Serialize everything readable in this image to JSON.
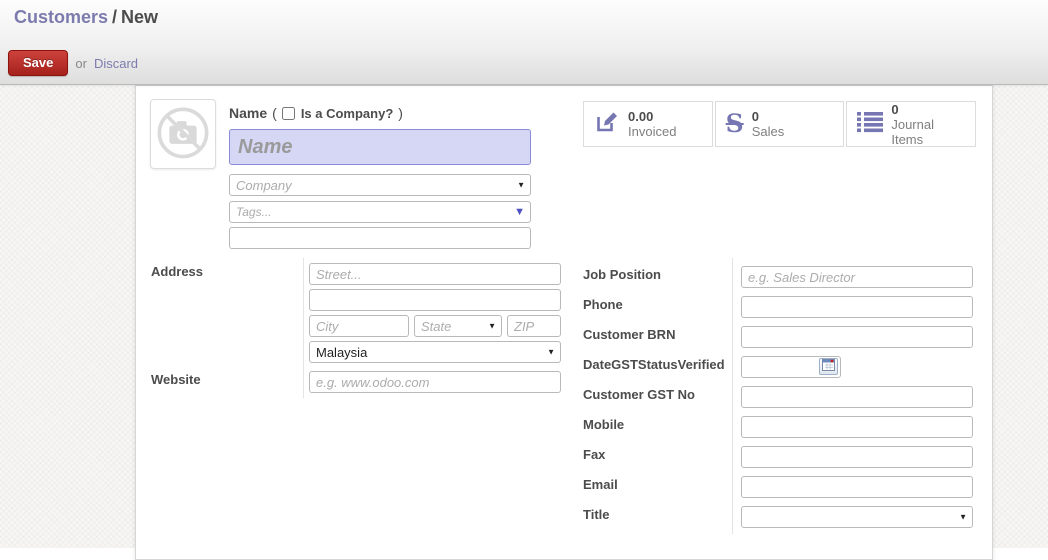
{
  "breadcrumb": {
    "section": "Customers",
    "separator": "/",
    "current": "New"
  },
  "actions": {
    "save": "Save",
    "or": "or",
    "discard": "Discard"
  },
  "colors": {
    "accent_purple": "#7c7bad",
    "save_red": "#b02a24",
    "focused_field_bg": "#d6d6f5",
    "focused_field_border": "#8a8ad6"
  },
  "icons": {
    "caret_down": "▼",
    "sales_glyph": "S",
    "avatar": "no-photo-camera-icon",
    "invoiced": "edit-pencil-icon",
    "journal": "list-icon",
    "date": "calendar-icon"
  },
  "name_block": {
    "label": "Name",
    "paren_open": "(",
    "checkbox_label": "Is a Company?",
    "paren_close": ")",
    "name_placeholder": "Name",
    "company_placeholder": "Company",
    "tags_placeholder": "Tags..."
  },
  "stats": [
    {
      "icon": "edit-pencil-icon",
      "value": "0.00",
      "label": "Invoiced"
    },
    {
      "icon": "sales-s-icon",
      "value": "0",
      "label": "Sales"
    },
    {
      "icon": "journal-list-icon",
      "value": "0",
      "label": "Journal Items"
    }
  ],
  "address_group": {
    "address_label": "Address",
    "street_placeholder": "Street...",
    "city_placeholder": "City",
    "state_placeholder": "State",
    "zip_placeholder": "ZIP",
    "country_value": "Malaysia",
    "website_label": "Website",
    "website_placeholder": "e.g. www.odoo.com"
  },
  "contact": {
    "rows": [
      {
        "label": "Job Position",
        "placeholder": "e.g. Sales Director"
      },
      {
        "label": "Phone",
        "placeholder": ""
      },
      {
        "label": "Customer BRN",
        "placeholder": ""
      },
      {
        "label": "DateGSTStatusVerified",
        "placeholder": ""
      },
      {
        "label": "Customer GST No",
        "placeholder": ""
      },
      {
        "label": "Mobile",
        "placeholder": ""
      },
      {
        "label": "Fax",
        "placeholder": ""
      },
      {
        "label": "Email",
        "placeholder": ""
      },
      {
        "label": "Title",
        "placeholder": ""
      }
    ]
  }
}
